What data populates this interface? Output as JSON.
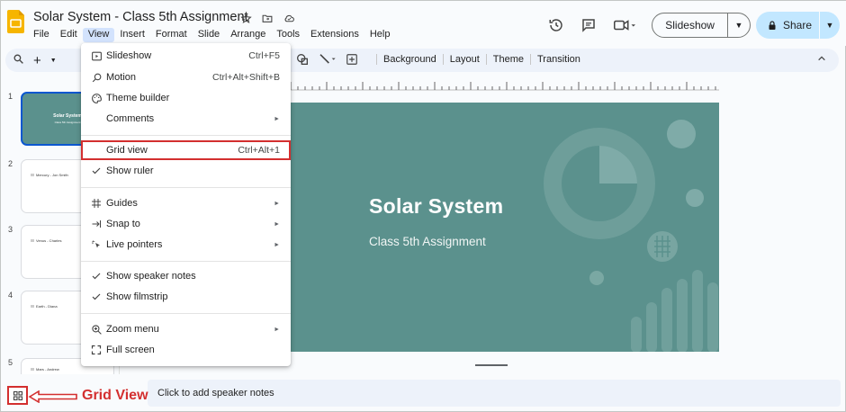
{
  "header": {
    "title": "Solar System - Class  5th Assignment",
    "menu": [
      "File",
      "Edit",
      "View",
      "Insert",
      "Format",
      "Slide",
      "Arrange",
      "Tools",
      "Extensions",
      "Help"
    ],
    "slideshow_label": "Slideshow",
    "share_label": "Share"
  },
  "toolbar": {
    "buttons": [
      "Background",
      "Layout",
      "Theme",
      "Transition"
    ]
  },
  "view_menu": {
    "items": [
      {
        "label": "Slideshow",
        "shortcut": "Ctrl+F5"
      },
      {
        "label": "Motion",
        "shortcut": "Ctrl+Alt+Shift+B"
      },
      {
        "label": "Theme builder",
        "shortcut": ""
      },
      {
        "label": "Comments",
        "shortcut": ""
      },
      {
        "label": "Grid view",
        "shortcut": "Ctrl+Alt+1"
      },
      {
        "label": "Show ruler",
        "shortcut": ""
      },
      {
        "label": "Guides",
        "shortcut": ""
      },
      {
        "label": "Snap to",
        "shortcut": ""
      },
      {
        "label": "Live pointers",
        "shortcut": ""
      },
      {
        "label": "Show speaker notes",
        "shortcut": ""
      },
      {
        "label": "Show filmstrip",
        "shortcut": ""
      },
      {
        "label": "Zoom menu",
        "shortcut": ""
      },
      {
        "label": "Full screen",
        "shortcut": ""
      }
    ]
  },
  "filmstrip": {
    "slides": [
      {
        "num": "1",
        "title": "Solar System",
        "subtitle": "Class 5th Assignment"
      },
      {
        "num": "2",
        "text": "Mercury - Jon Smith"
      },
      {
        "num": "3",
        "text": "Venus - Charles"
      },
      {
        "num": "4",
        "text": "Earth - Diana"
      },
      {
        "num": "5",
        "text": "Mars - Andrew"
      }
    ]
  },
  "slide": {
    "title": "Solar System",
    "subtitle": "Class 5th Assignment"
  },
  "notes_placeholder": "Click to add speaker notes",
  "annotation": {
    "label": "Grid View",
    "color": "#d32f2f"
  },
  "colors": {
    "slide_bg": "#5b918d",
    "accent": "#0b57d0",
    "share_bg": "#c2e7ff"
  }
}
